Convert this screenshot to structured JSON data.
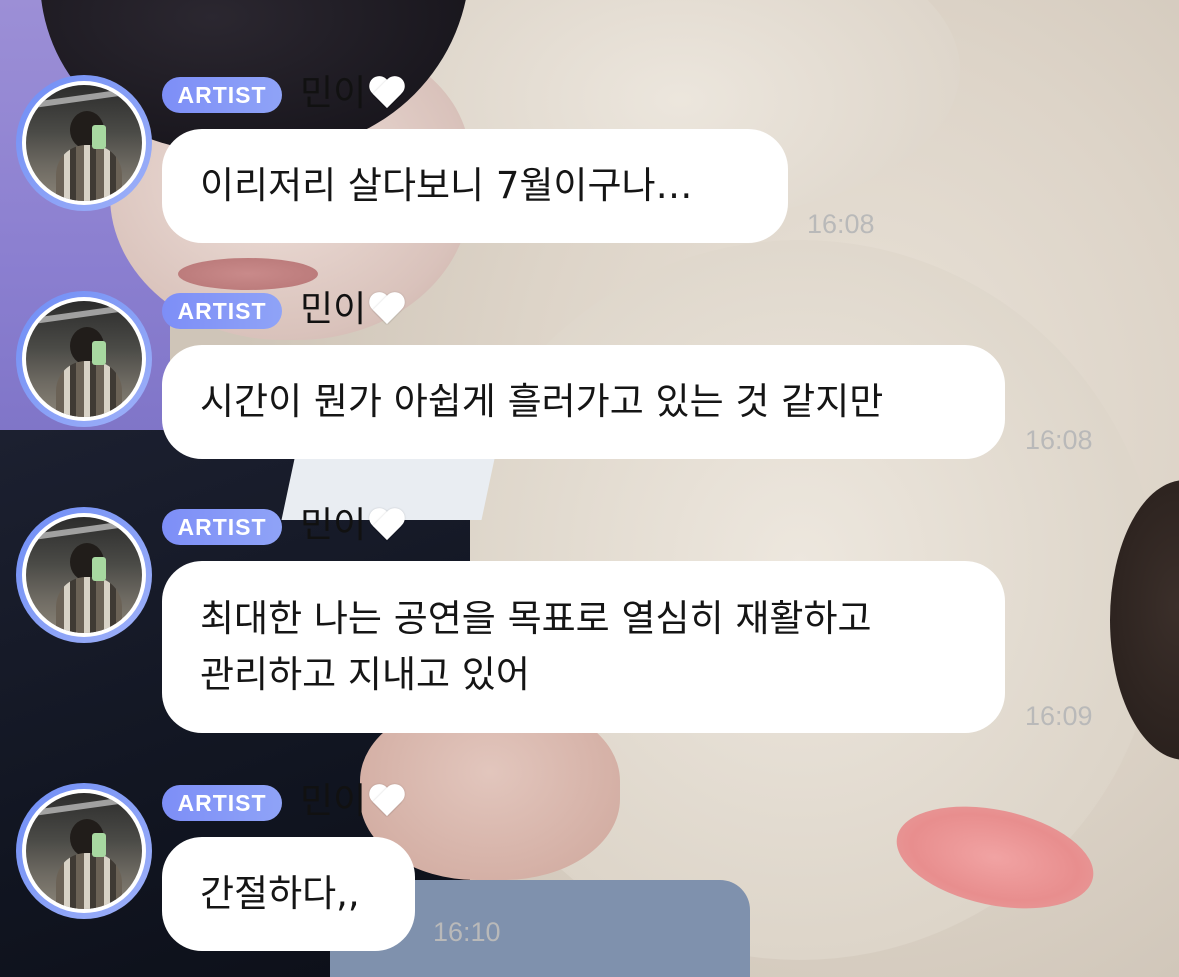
{
  "badge_label": "ARTIST",
  "messages": [
    {
      "sender": "민이",
      "text": "이리저리 살다보니 7월이구나…",
      "time": "16:08"
    },
    {
      "sender": "민이",
      "text": "시간이 뭔가 아쉽게 흘러가고 있는 것 같지만",
      "time": "16:08"
    },
    {
      "sender": "민이",
      "text": "최대한 나는 공연을 목표로 열심히 재활하고\n관리하고 지내고 있어",
      "time": "16:09"
    },
    {
      "sender": "민이",
      "text": "간절하다,,",
      "time": "16:10"
    }
  ],
  "icons": {
    "sender_emoji": "white-heart-icon",
    "avatar": "profile-avatar"
  },
  "colors": {
    "badge": "#7d8ef7",
    "bubble": "#ffffff",
    "avatar_ring": "#6f8df5",
    "time": "#b9b9b9"
  }
}
